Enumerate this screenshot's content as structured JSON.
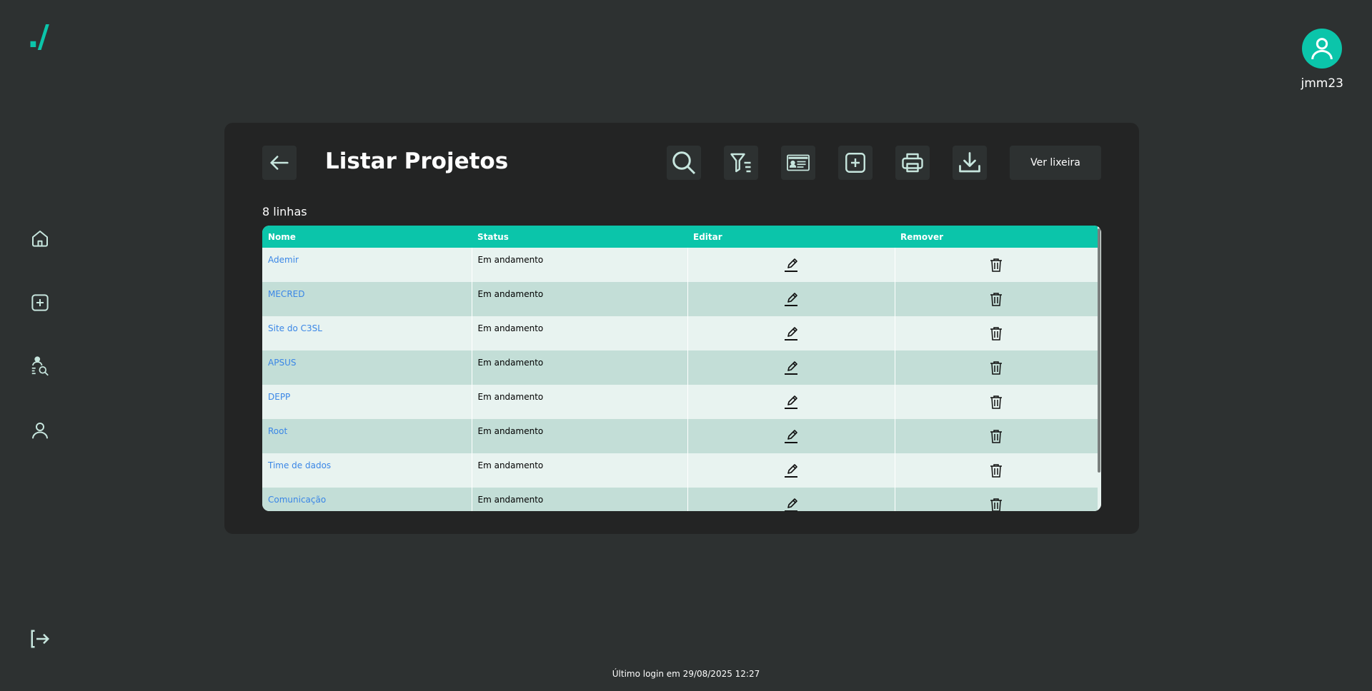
{
  "app": {
    "logo": "./",
    "username": "jmm23",
    "last_login": "Último login em 29/08/2025 12:27"
  },
  "sidebar": {
    "items": [
      {
        "icon": "home-icon"
      },
      {
        "icon": "add-square-icon"
      },
      {
        "icon": "user-search-icon"
      },
      {
        "icon": "user-icon"
      }
    ],
    "logout_icon": "logout-icon"
  },
  "page": {
    "title": "Listar Projetos",
    "row_count": "8 linhas",
    "toolbar": {
      "icons": [
        "search-icon",
        "filter-icon",
        "id-card-icon",
        "add-icon",
        "print-icon",
        "download-icon"
      ],
      "trash_label": "Ver lixeira"
    }
  },
  "table": {
    "headers": [
      "Nome",
      "Status",
      "Editar",
      "Remover"
    ],
    "rows": [
      {
        "nome": "Ademir",
        "status": "Em andamento"
      },
      {
        "nome": "MECRED",
        "status": "Em andamento"
      },
      {
        "nome": "Site do C3SL",
        "status": "Em andamento"
      },
      {
        "nome": "APSUS",
        "status": "Em andamento"
      },
      {
        "nome": "DEPP",
        "status": "Em andamento"
      },
      {
        "nome": "Root",
        "status": "Em andamento"
      },
      {
        "nome": "Time de dados",
        "status": "Em andamento"
      },
      {
        "nome": "Comunicação",
        "status": "Em andamento"
      }
    ]
  },
  "colors": {
    "background": "#2d3131",
    "panel": "#232424",
    "accent": "#0bc5aa",
    "row_light": "#e8f3f0",
    "row_dark": "#c3ded7",
    "link": "#3a86e6"
  }
}
